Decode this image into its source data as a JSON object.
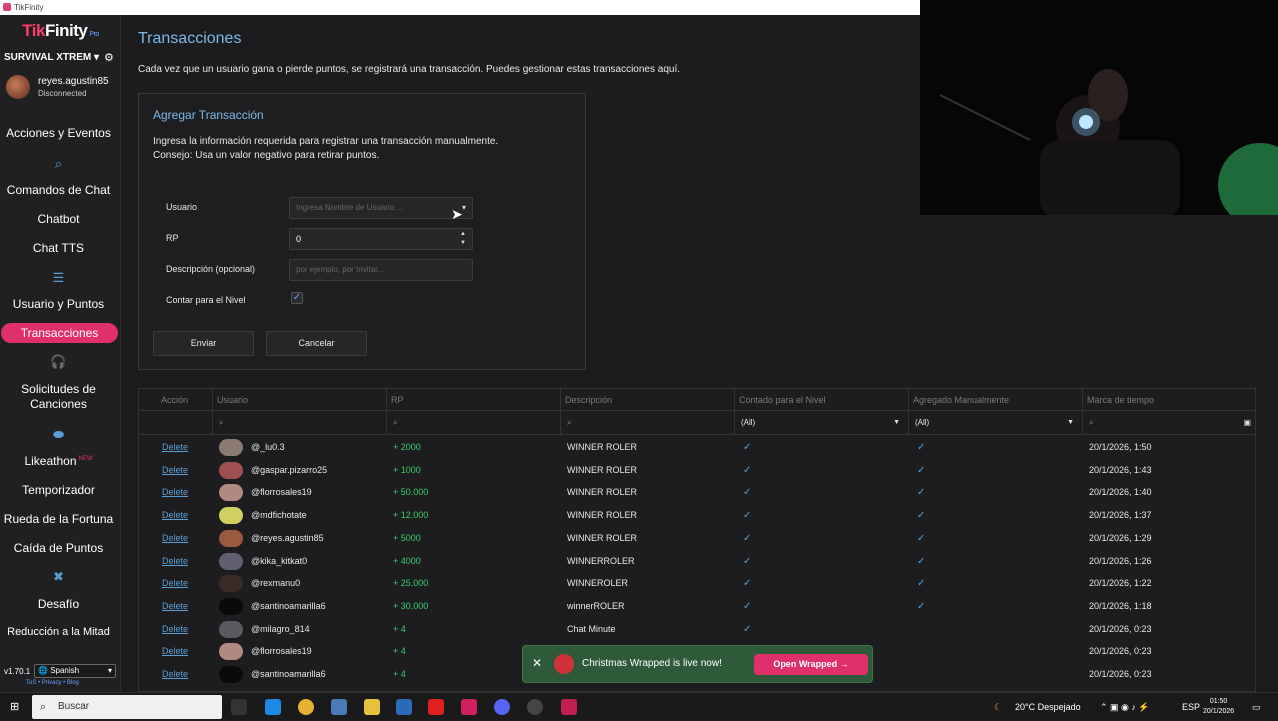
{
  "window": {
    "title": "TikFinity"
  },
  "sidebar": {
    "logo_tik": "Tik",
    "logo_finity": "Finity",
    "logo_pro": "Pro",
    "profile": "SURVIVAL XTREM",
    "user": {
      "name": "reyes.agustin85",
      "status": "Disconnected"
    },
    "items": [
      {
        "label": "Acciones y Eventos"
      },
      {
        "label": "Comandos de Chat"
      },
      {
        "label": "Chatbot"
      },
      {
        "label": "Chat TTS"
      },
      {
        "label": "Usuario y Puntos"
      },
      {
        "label": "Transacciones"
      },
      {
        "label": "Solicitudes de Canciones"
      },
      {
        "label": "Likeathon",
        "badge": "NEW"
      },
      {
        "label": "Temporizador"
      },
      {
        "label": "Rueda de la Fortuna"
      },
      {
        "label": "Caída de Puntos"
      },
      {
        "label": "Desafío"
      },
      {
        "label": "Reducción a la Mitad"
      }
    ],
    "version": "v1.70.1",
    "language": "Spanish",
    "links": "ToS • Privacy • Blog"
  },
  "main": {
    "title": "Transacciones",
    "description": "Cada vez que un usuario gana o pierde puntos, se registrará una transacción. Puedes gestionar estas transacciones aquí.",
    "form": {
      "title": "Agregar Transacción",
      "desc1": "Ingresa la información requerida para registrar una transacción manualmente.",
      "desc2": "Consejo: Usa un valor negativo para retirar puntos.",
      "user_label": "Usuario",
      "user_placeholder": "Ingresa Nombre de Usuario ...",
      "rp_label": "RP",
      "rp_value": "0",
      "desc_label": "Descripción (opcional)",
      "desc_placeholder": "por ejemplo, por Invitar...",
      "level_label": "Contar para el Nivel",
      "submit": "Enviar",
      "cancel": "Cancelar"
    },
    "grid": {
      "columns": [
        "Acción",
        "Usuario",
        "RP",
        "Descripción",
        "Contado para el Nivel",
        "Agregado Manualmente",
        "Marca de tiempo"
      ],
      "filters": {
        "level": "(All)",
        "manual": "(All)"
      },
      "rows": [
        {
          "action": "Delete",
          "user": "@_lu0.3",
          "rp": "+ 2000",
          "desc": "WINNER ROLER",
          "level": true,
          "manual": true,
          "time": "20/1/2026, 1:50",
          "avatar": "#8a7a70"
        },
        {
          "action": "Delete",
          "user": "@gaspar.pizarro25",
          "rp": "+ 1000",
          "desc": "WINNER ROLER",
          "level": true,
          "manual": true,
          "time": "20/1/2026, 1:43",
          "avatar": "#a05050"
        },
        {
          "action": "Delete",
          "user": "@florrosales19",
          "rp": "+ 50.000",
          "desc": "WINNER ROLER",
          "level": true,
          "manual": true,
          "time": "20/1/2026, 1:40",
          "avatar": "#b08a80"
        },
        {
          "action": "Delete",
          "user": "@mdfichotate",
          "rp": "+ 12.000",
          "desc": "WINNER ROLER",
          "level": true,
          "manual": true,
          "time": "20/1/2026, 1:37",
          "avatar": "#d0d060"
        },
        {
          "action": "Delete",
          "user": "@reyes.agustin85",
          "rp": "+ 5000",
          "desc": "WINNER ROLER",
          "level": true,
          "manual": true,
          "time": "20/1/2026, 1:29",
          "avatar": "#9a5a40"
        },
        {
          "action": "Delete",
          "user": "@kika_kitkat0",
          "rp": "+ 4000",
          "desc": "WINNERROLER",
          "level": true,
          "manual": true,
          "time": "20/1/2026, 1:26",
          "avatar": "#606070"
        },
        {
          "action": "Delete",
          "user": "@rexmanu0",
          "rp": "+ 25.000",
          "desc": "WINNEROLER",
          "level": true,
          "manual": true,
          "time": "20/1/2026, 1:22",
          "avatar": "#3a2a28"
        },
        {
          "action": "Delete",
          "user": "@santinoamarilla6",
          "rp": "+ 30.000",
          "desc": "winnerROLER",
          "level": true,
          "manual": true,
          "time": "20/1/2026, 1:18",
          "avatar": "#0a0a0a"
        },
        {
          "action": "Delete",
          "user": "@milagro_814",
          "rp": "+ 4",
          "desc": "Chat Minute",
          "level": true,
          "manual": false,
          "time": "20/1/2026, 0:23",
          "avatar": "#5a5a60"
        },
        {
          "action": "Delete",
          "user": "@florrosales19",
          "rp": "+ 4",
          "desc": "",
          "level": false,
          "manual": false,
          "time": "20/1/2026, 0:23",
          "avatar": "#b08a80"
        },
        {
          "action": "Delete",
          "user": "@santinoamarilla6",
          "rp": "+ 4",
          "desc": "",
          "level": false,
          "manual": false,
          "time": "20/1/2026, 0:23",
          "avatar": "#0a0a0a"
        }
      ]
    }
  },
  "toast": {
    "text": "Christmas Wrapped is live now!",
    "button": "Open Wrapped"
  },
  "taskbar": {
    "search": "Buscar",
    "weather": "20°C  Despejado",
    "lang": "ESP",
    "time": "01:50",
    "date": "20/1/2026"
  },
  "colors": {
    "accent": "#e0306c",
    "link": "#5a9ed6",
    "positive": "#3bcf6b",
    "title": "#7db8e8"
  }
}
